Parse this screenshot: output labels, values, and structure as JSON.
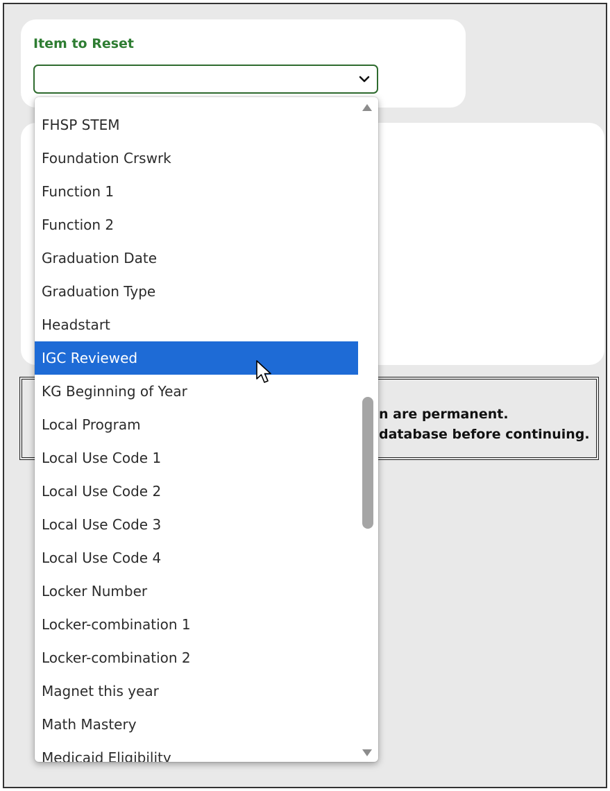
{
  "item_to_reset": {
    "label": "Item to Reset",
    "value": "",
    "chevron_icon": "chevron-down-icon"
  },
  "dropdown": {
    "options": [
      "FHSP STEM",
      "Foundation Crswrk",
      "Function 1",
      "Function 2",
      "Graduation Date",
      "Graduation Type",
      "Headstart",
      "IGC Reviewed",
      "KG Beginning of Year",
      "Local Program",
      "Local Use Code 1",
      "Local Use Code 2",
      "Local Use Code 3",
      "Local Use Code 4",
      "Locker Number",
      "Locker-combination 1",
      "Locker-combination 2",
      "Magnet this year",
      "Math Mastery",
      "Medicaid Eligibility"
    ],
    "highlighted": "IGC Reviewed",
    "highlight_color": "#1e6bd6"
  },
  "warning": {
    "line1": "n are permanent.",
    "line2": "database before continuing."
  },
  "colors": {
    "label_green": "#2e7d32",
    "select_border": "#2e6b2e",
    "page_background": "#e9e9e9"
  }
}
